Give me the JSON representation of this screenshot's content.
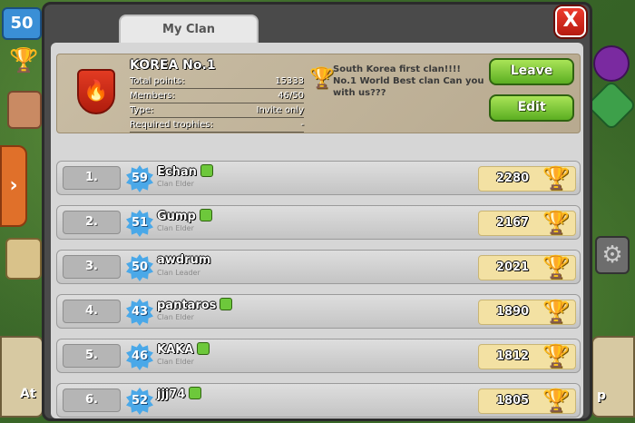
{
  "hud": {
    "level_badge": "50",
    "attack_label": "At",
    "shop_label": "p"
  },
  "panel": {
    "tab_label": "My Clan",
    "close_label": "X"
  },
  "clan": {
    "name": "KOREA No.1",
    "stats": [
      {
        "label": "Total points:",
        "value": "15333"
      },
      {
        "label": "Members:",
        "value": "46/50"
      },
      {
        "label": "Type:",
        "value": "Invite only"
      },
      {
        "label": "Required trophies:",
        "value": "-"
      }
    ],
    "description": "South Korea first clan!!!! No.1 World Best clan Can you with us???",
    "leave_label": "Leave",
    "edit_label": "Edit"
  },
  "members": [
    {
      "rank": "1.",
      "level": "59",
      "name": "Echan",
      "role": "Clan Elder",
      "trophies": "2280",
      "league_icon": true
    },
    {
      "rank": "2.",
      "level": "51",
      "name": "Gump",
      "role": "Clan Elder",
      "trophies": "2167",
      "league_icon": true
    },
    {
      "rank": "3.",
      "level": "50",
      "name": "awdrum",
      "role": "Clan Leader",
      "trophies": "2021",
      "league_icon": false
    },
    {
      "rank": "4.",
      "level": "43",
      "name": "pantaros",
      "role": "Clan Elder",
      "trophies": "1890",
      "league_icon": true
    },
    {
      "rank": "5.",
      "level": "46",
      "name": "KAKA",
      "role": "Clan Elder",
      "trophies": "1812",
      "league_icon": true
    },
    {
      "rank": "6.",
      "level": "52",
      "name": "jjj74",
      "role": "",
      "trophies": "1805",
      "league_icon": true
    }
  ],
  "colors": {
    "accent_green": "#5bae22",
    "close_red": "#d12a1c",
    "trophy_gold": "#f2b51a",
    "level_blue": "#4aa8e8"
  }
}
